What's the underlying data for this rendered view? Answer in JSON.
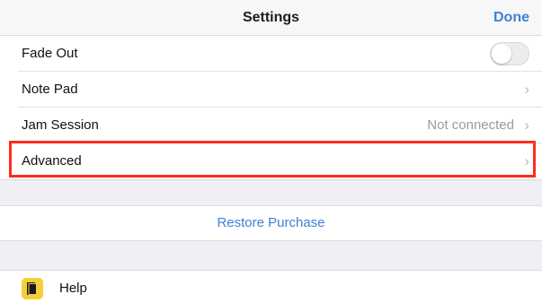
{
  "navbar": {
    "title": "Settings",
    "done_label": "Done"
  },
  "settings": {
    "fade_out": {
      "label": "Fade Out",
      "toggle_on": false
    },
    "note_pad": {
      "label": "Note Pad",
      "chevron": "›"
    },
    "jam_session": {
      "label": "Jam Session",
      "detail": "Not connected",
      "chevron": "›"
    },
    "advanced": {
      "label": "Advanced",
      "chevron": "›"
    }
  },
  "restore": {
    "label": "Restore Purchase"
  },
  "help": {
    "label": "Help",
    "icon": "help-book-icon"
  },
  "colors": {
    "accent": "#3b82d6",
    "highlight": "#ff2b1c",
    "help_icon_bg": "#f5cf3a",
    "group_gap": "#efeff4"
  }
}
